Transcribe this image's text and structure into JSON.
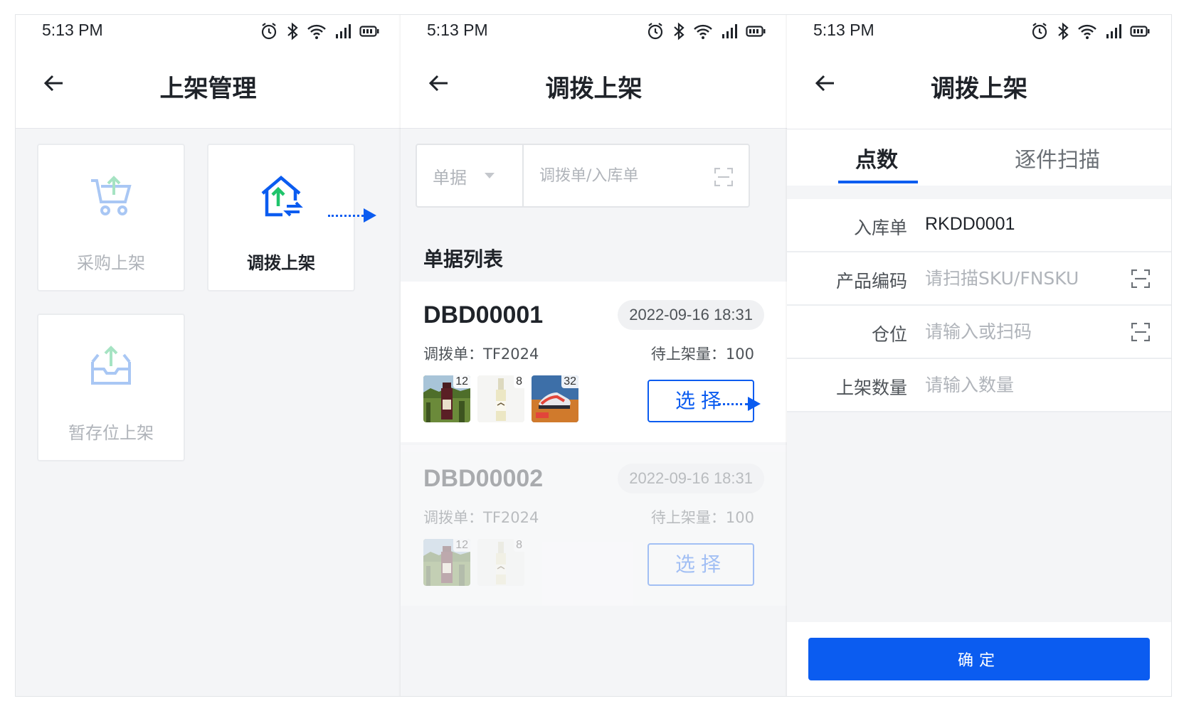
{
  "status_bar": {
    "time": "5:13 PM"
  },
  "screen1": {
    "title": "上架管理",
    "menu": [
      {
        "label": "采购上架",
        "icon": "cart-upload-icon",
        "active": false
      },
      {
        "label": "调拨上架",
        "icon": "house-transfer-icon",
        "active": true
      },
      {
        "label": "暂存位上架",
        "icon": "inbox-upload-icon",
        "active": false
      }
    ]
  },
  "screen2": {
    "title": "调拨上架",
    "search": {
      "type_label": "单据",
      "placeholder": "调拨单/入库单"
    },
    "section_title": "单据列表",
    "orders": [
      {
        "order_no": "DBD00001",
        "time": "2022-09-16 18:31",
        "transfer_text": "调拨单：TF2024",
        "pending_text": "待上架量：100",
        "thumbnails": [
          {
            "icon": "wine-vineyard-photo",
            "count": "12"
          },
          {
            "icon": "white-wine-bottle-photo",
            "count": "8"
          },
          {
            "icon": "sneaker-photo",
            "count": "32"
          }
        ],
        "select_label": "选择"
      },
      {
        "order_no": "DBD00002",
        "time": "2022-09-16 18:31",
        "transfer_text": "调拨单：TF2024",
        "pending_text": "待上架量：100",
        "thumbnails": [
          {
            "icon": "wine-vineyard-photo",
            "count": "12"
          },
          {
            "icon": "white-wine-bottle-photo",
            "count": "8"
          }
        ],
        "select_label": "选择"
      }
    ]
  },
  "screen3": {
    "title": "调拨上架",
    "tabs": {
      "active": "点数",
      "inactive": "逐件扫描"
    },
    "form": {
      "inbound_label": "入库单",
      "inbound_value": "RKDD0001",
      "product_label": "产品编码",
      "product_placeholder": "请扫描SKU/FNSKU",
      "location_label": "仓位",
      "location_placeholder": "请输入或扫码",
      "qty_label": "上架数量",
      "qty_placeholder": "请输入数量"
    },
    "confirm_label": "确定"
  },
  "colors": {
    "primary": "#0b5cf0",
    "green": "#1fc46b",
    "muted": "#b0b4ba"
  }
}
